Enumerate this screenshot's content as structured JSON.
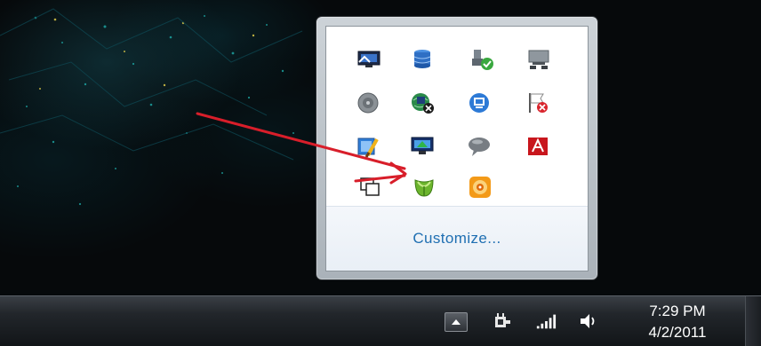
{
  "flyout": {
    "customize_label": "Customize...",
    "icons": [
      {
        "name": "display-settings-icon"
      },
      {
        "name": "database-icon"
      },
      {
        "name": "usb-safely-remove-icon"
      },
      {
        "name": "network-drive-icon"
      },
      {
        "name": "speaker-gray-icon"
      },
      {
        "name": "network-globe-icon"
      },
      {
        "name": "monitor-blue-icon"
      },
      {
        "name": "flag-error-icon"
      },
      {
        "name": "paint-brush-icon"
      },
      {
        "name": "display-arrow-icon"
      },
      {
        "name": "chat-bubble-icon"
      },
      {
        "name": "adobe-icon"
      },
      {
        "name": "windows-overlap-icon"
      },
      {
        "name": "green-leaf-icon"
      },
      {
        "name": "orange-disc-icon"
      }
    ]
  },
  "taskbar": {
    "time": "7:29 PM",
    "date": "4/2/2011"
  },
  "colors": {
    "annotation_arrow": "#d81e2a",
    "link": "#1f6fb2"
  }
}
